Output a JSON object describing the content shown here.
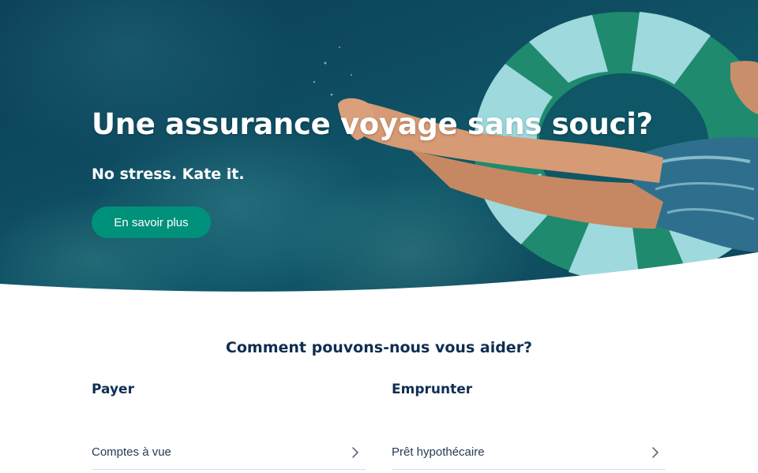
{
  "hero": {
    "title": "Une assurance voyage sans souci?",
    "subtitle": "No stress. Kate it.",
    "cta_label": "En savoir plus"
  },
  "help": {
    "title": "Comment pouvons-nous vous aider?",
    "columns": [
      {
        "heading": "Payer",
        "link_label": "Comptes à vue",
        "link_icon": "chevron-right-icon"
      },
      {
        "heading": "Emprunter",
        "link_label": "Prêt hypothécaire",
        "link_icon": "chevron-right-icon"
      }
    ]
  },
  "colors": {
    "accent": "#00917a",
    "heading_text": "#0f2e52",
    "water": "#0e4b60",
    "float_green": "#1f8a6e",
    "float_light": "#9ed9dd"
  }
}
